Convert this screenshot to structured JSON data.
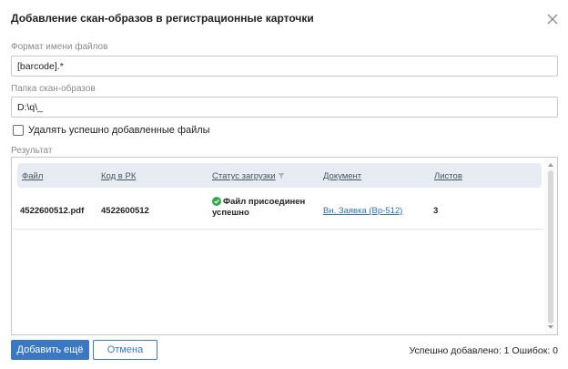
{
  "dialog": {
    "title": "Добавление скан-образов в регистрационные карточки"
  },
  "fields": {
    "format_label": "Формат имени файлов",
    "format_value": "[barcode].*",
    "folder_label": "Папка скан-образов",
    "folder_value": "D:\\q\\_"
  },
  "options": {
    "delete_label": "Удалять успешно добавленные файлы",
    "delete_checked": false
  },
  "result": {
    "label": "Результат",
    "columns": [
      "Файл",
      "Код в РК",
      "Статус загрузки",
      "Документ",
      "Листов"
    ],
    "rows": [
      {
        "file": "4522600512.pdf",
        "code": "4522600512",
        "status": "Файл присоединен успешно",
        "document": "Вн. Заявка (Вр-512)",
        "sheets": "3"
      }
    ]
  },
  "buttons": {
    "add_more": "Добавить ещё",
    "cancel": "Отмена"
  },
  "summary": {
    "text": "Успешно добавлено: 1   Ошибок: 0"
  },
  "colors": {
    "primary": "#3b78c4",
    "link": "#2f6fb5",
    "success": "#2eaa4a",
    "header_bg": "#e6ecf1"
  },
  "icons": {
    "close": "close-icon",
    "filter": "filter-icon",
    "status_ok": "check-circle-icon"
  }
}
